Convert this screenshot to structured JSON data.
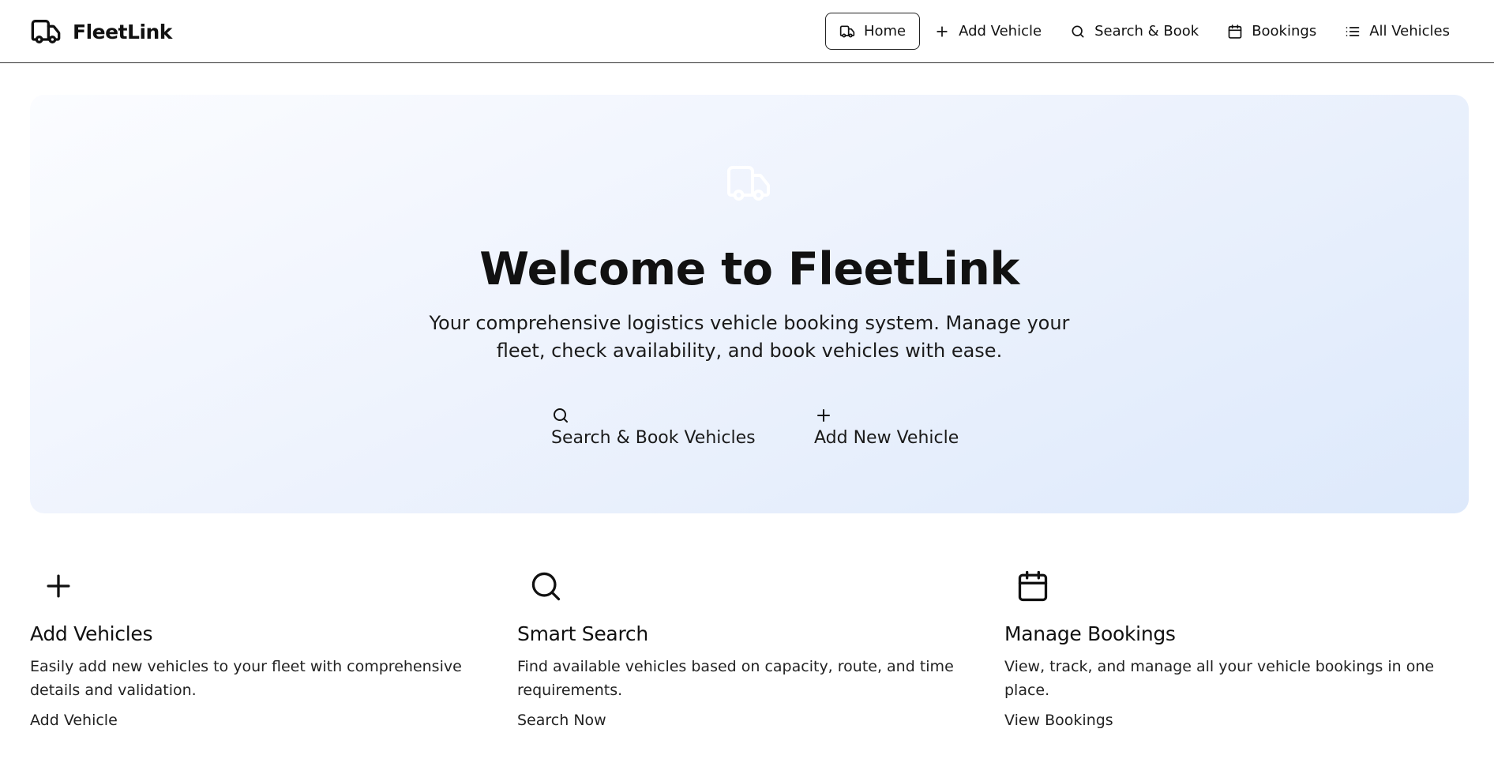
{
  "app": {
    "name": "FleetLink"
  },
  "nav": {
    "items": [
      {
        "label": "Home",
        "icon": "truck-icon",
        "active": true
      },
      {
        "label": "Add Vehicle",
        "icon": "plus-icon",
        "active": false
      },
      {
        "label": "Search & Book",
        "icon": "search-icon",
        "active": false
      },
      {
        "label": "Bookings",
        "icon": "calendar-icon",
        "active": false
      },
      {
        "label": "All Vehicles",
        "icon": "list-icon",
        "active": false
      }
    ]
  },
  "hero": {
    "icon": "truck-icon",
    "title": "Welcome to FleetLink",
    "subtitle": "Your comprehensive logistics vehicle booking system. Manage your fleet, check availability, and book vehicles with ease.",
    "buttons": [
      {
        "label": "Search & Book Vehicles",
        "icon": "search-icon"
      },
      {
        "label": "Add New Vehicle",
        "icon": "plus-icon"
      }
    ]
  },
  "features": [
    {
      "icon": "plus-icon",
      "title": "Add Vehicles",
      "description": "Easily add new vehicles to your fleet with comprehensive details and validation.",
      "link": "Add Vehicle"
    },
    {
      "icon": "search-icon",
      "title": "Smart Search",
      "description": "Find available vehicles based on capacity, route, and time requirements.",
      "link": "Search Now"
    },
    {
      "icon": "calendar-icon",
      "title": "Manage Bookings",
      "description": "View, track, and manage all your vehicle bookings in one place.",
      "link": "View Bookings"
    }
  ],
  "colors": {
    "text": "#111111",
    "hero_gradient_start": "#fbfcff",
    "hero_gradient_end": "#dde9fb",
    "header_border": "#333333"
  }
}
